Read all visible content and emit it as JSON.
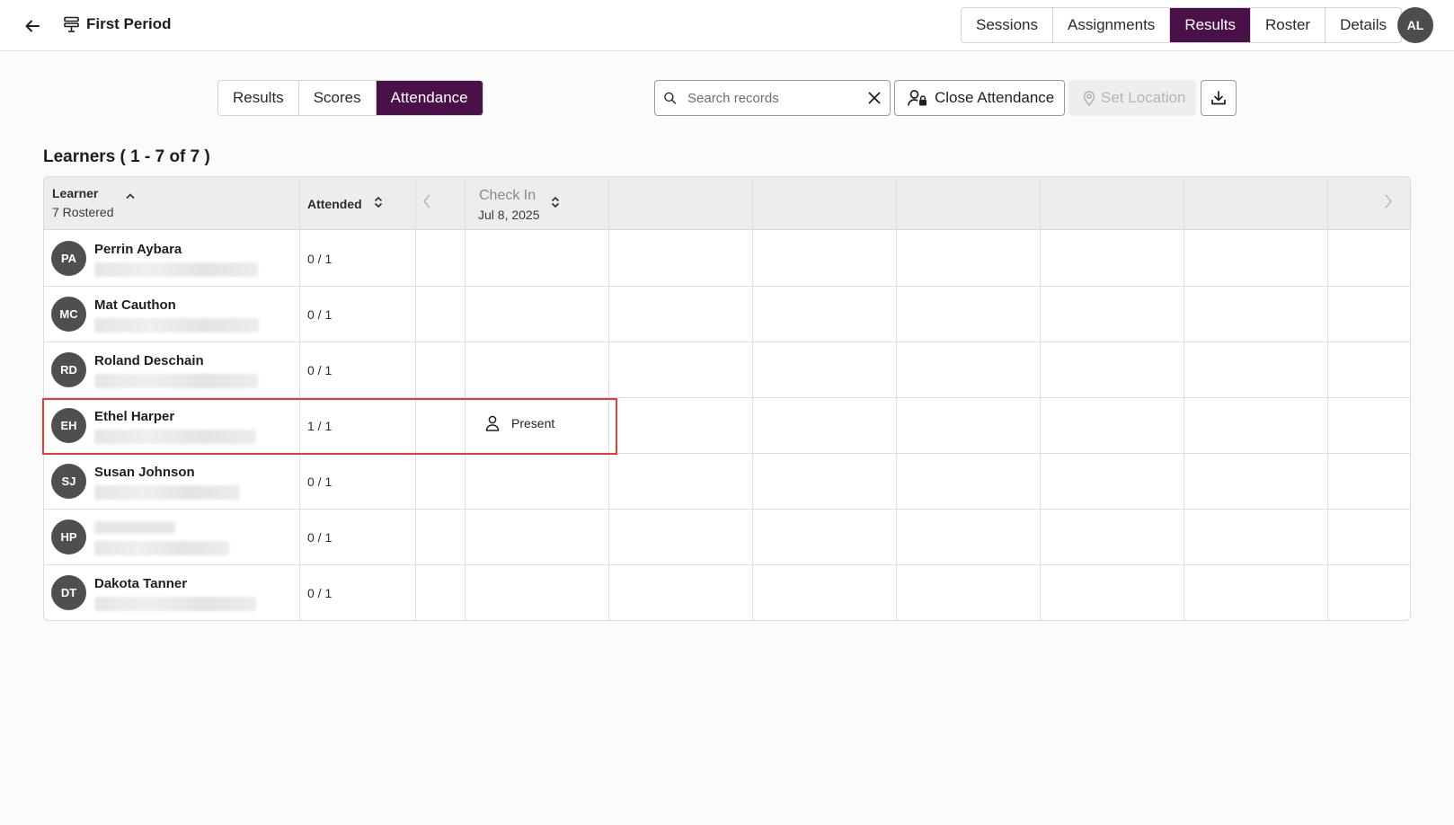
{
  "header": {
    "title": "First Period",
    "nav": [
      "Sessions",
      "Assignments",
      "Results",
      "Roster",
      "Details"
    ],
    "active_nav": "Results",
    "user_initials": "AL"
  },
  "sub_tabs": [
    "Results",
    "Scores",
    "Attendance"
  ],
  "active_sub_tab": "Attendance",
  "toolbar": {
    "search_placeholder": "Search records",
    "search_value": "",
    "close_attendance_label": "Close Attendance",
    "set_location_label": "Set Location"
  },
  "learners_title": "Learners ( 1 - 7 of 7 )",
  "table": {
    "col_learner": "Learner",
    "rostered": "7 Rostered",
    "col_attended": "Attended",
    "col_checkin": "Check In",
    "checkin_date": "Jul 8, 2025"
  },
  "rows": [
    {
      "initials": "PA",
      "name": "Perrin Aybara",
      "attended": "0 / 1",
      "checkin": ""
    },
    {
      "initials": "MC",
      "name": "Mat Cauthon",
      "attended": "0 / 1",
      "checkin": ""
    },
    {
      "initials": "RD",
      "name": "Roland Deschain",
      "attended": "0 / 1",
      "checkin": ""
    },
    {
      "initials": "EH",
      "name": "Ethel Harper",
      "attended": "1 / 1",
      "checkin": "Present"
    },
    {
      "initials": "SJ",
      "name": "Susan Johnson",
      "attended": "0 / 1",
      "checkin": ""
    },
    {
      "initials": "HP",
      "name": "",
      "attended": "0 / 1",
      "checkin": ""
    },
    {
      "initials": "DT",
      "name": "Dakota Tanner",
      "attended": "0 / 1",
      "checkin": ""
    }
  ],
  "colors": {
    "accent": "#4a1148",
    "highlight": "#e53b3b",
    "avatar": "#4f4f4f"
  }
}
